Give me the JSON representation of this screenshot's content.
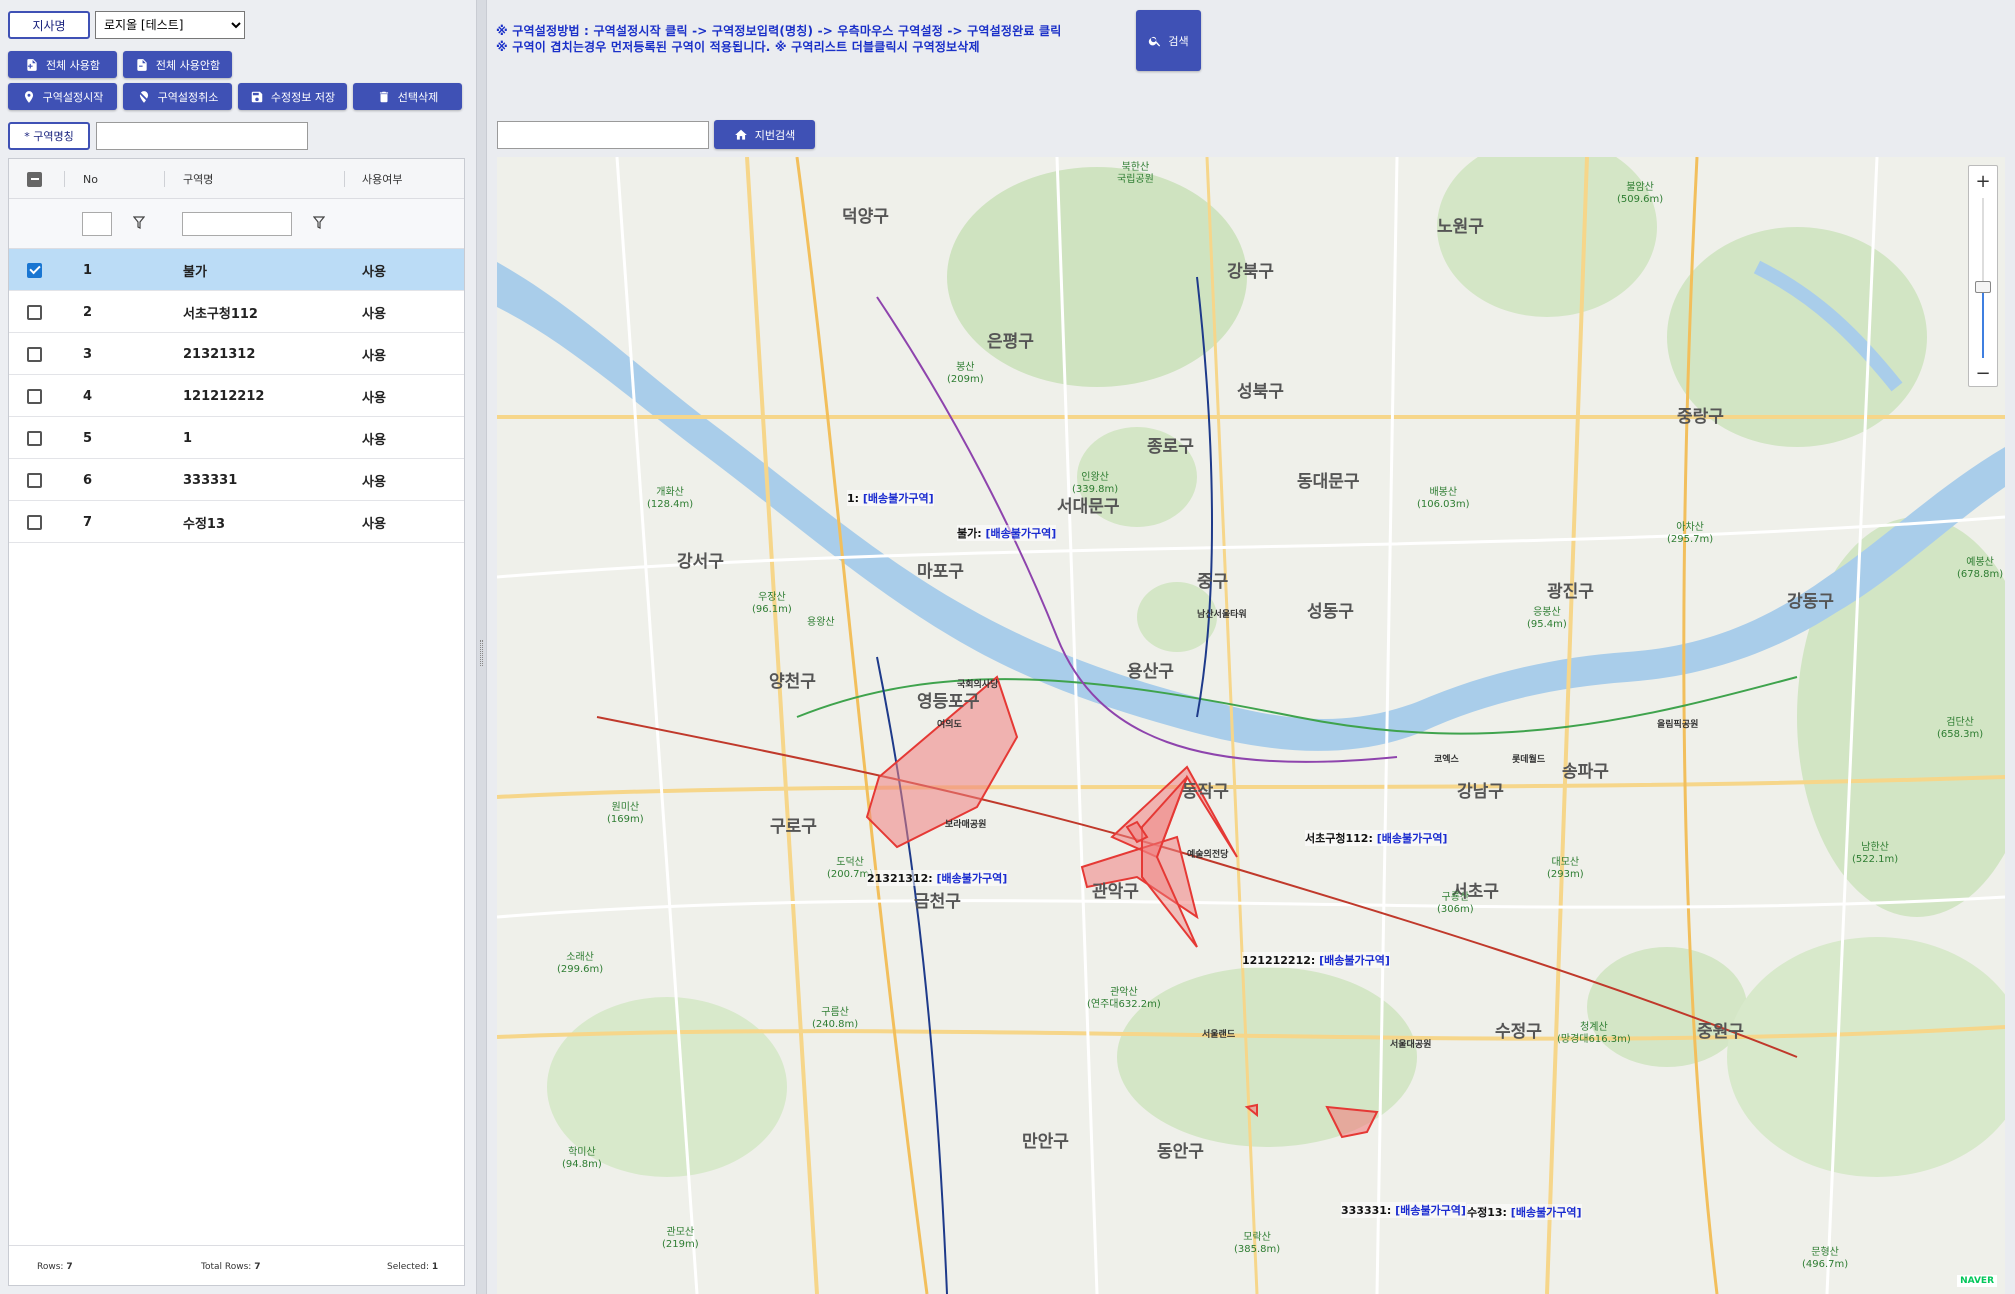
{
  "left_panel": {
    "branch_label": "지사명",
    "branch_select": "로지올 [테스트]",
    "buttons": {
      "enable_all": "전체 사용함",
      "disable_all": "전체 사용안함",
      "start_zone": "구역설정시작",
      "cancel_zone": "구역설정취소",
      "save_edit": "수정정보 저장",
      "delete_selected": "선택삭제"
    },
    "zone_name_label": "* 구역명칭",
    "zone_name_value": "",
    "grid": {
      "headers": {
        "no": "No",
        "name": "구역명",
        "use": "사용여부"
      },
      "rows": [
        {
          "no": "1",
          "name": "불가",
          "use": "사용",
          "checked": true
        },
        {
          "no": "2",
          "name": "서초구청112",
          "use": "사용",
          "checked": false
        },
        {
          "no": "3",
          "name": "21321312",
          "use": "사용",
          "checked": false
        },
        {
          "no": "4",
          "name": "121212212",
          "use": "사용",
          "checked": false
        },
        {
          "no": "5",
          "name": "1",
          "use": "사용",
          "checked": false
        },
        {
          "no": "6",
          "name": "333331",
          "use": "사용",
          "checked": false
        },
        {
          "no": "7",
          "name": "수정13",
          "use": "사용",
          "checked": false
        }
      ],
      "footer": {
        "rows_label": "Rows:",
        "rows": "7",
        "total_label": "Total Rows:",
        "total": "7",
        "selected_label": "Selected:",
        "selected": "1"
      }
    }
  },
  "right_panel": {
    "notice_line1": "※ 구역설정방법 : 구역설정시작 클릭 -> 구역정보입력(명칭) -> 우측마우스 구역설정 -> 구역설정완료 클릭",
    "notice_line2": "※ 구역이 겹치는경우 먼저등록된 구역이 적용됩니다. ※ 구역리스트 더블클릭시 구역정보삭제",
    "search_button": "검색",
    "address_input": "",
    "address_search_button": "지번검색"
  },
  "map": {
    "zone_tag": "[배송불가구역]",
    "zone_labels": [
      {
        "name": "1:",
        "tag": "[배송불가구역]"
      },
      {
        "name": "불가:",
        "tag": "[배송불가구역]"
      },
      {
        "name": "서초구청112:",
        "tag": "[배송불가구역]"
      },
      {
        "name": "21321312:",
        "tag": "[배송불가구역]"
      },
      {
        "name": "121212212:",
        "tag": "[배송불가구역]"
      },
      {
        "name": "333331:",
        "tag": "[배송불가구역]"
      },
      {
        "name": "수정13:",
        "tag": "[배송불가구역]"
      }
    ],
    "districts": [
      "덕양구",
      "강북구",
      "노원구",
      "은평구",
      "성북구",
      "종로구",
      "중랑구",
      "서대문구",
      "동대문구",
      "강서구",
      "마포구",
      "중구",
      "성동구",
      "광진구",
      "강동구",
      "양천구",
      "영등포구",
      "용산구",
      "동작구",
      "구로구",
      "강남구",
      "송파구",
      "서초구",
      "금천구",
      "관악구",
      "수정구",
      "중원구",
      "만안구",
      "동안구"
    ],
    "pois": [
      {
        "t": "북한산",
        "s": "국립공원"
      },
      {
        "t": "불암산",
        "s": "(509.6m)"
      },
      {
        "t": "봉산",
        "s": "(209m)"
      },
      {
        "t": "인왕산",
        "s": "(339.8m)"
      },
      {
        "t": "배봉산",
        "s": "(106.03m)"
      },
      {
        "t": "개화산",
        "s": "(128.4m)"
      },
      {
        "t": "아차산",
        "s": "(295.7m)"
      },
      {
        "t": "우장산",
        "s": "(96.1m)"
      },
      {
        "t": "용왕산",
        "s": ""
      },
      {
        "t": "응봉산",
        "s": "(95.4m)"
      },
      {
        "t": "원미산",
        "s": "(169m)"
      },
      {
        "t": "도덕산",
        "s": "(200.7m)"
      },
      {
        "t": "대모산",
        "s": "(293m)"
      },
      {
        "t": "구룡산",
        "s": "(306m)"
      },
      {
        "t": "예봉산",
        "s": "(678.8m)"
      },
      {
        "t": "검단산",
        "s": "(658.3m)"
      },
      {
        "t": "남한산",
        "s": "(522.1m)"
      },
      {
        "t": "소래산",
        "s": "(299.6m)"
      },
      {
        "t": "구름산",
        "s": "(240.8m)"
      },
      {
        "t": "관악산",
        "s": "(연주대632.2m)"
      },
      {
        "t": "청계산",
        "s": "(망경대616.3m)"
      },
      {
        "t": "학미산",
        "s": "(94.8m)"
      },
      {
        "t": "관모산",
        "s": "(219m)"
      },
      {
        "t": "모락산",
        "s": "(385.8m)"
      },
      {
        "t": "문형산",
        "s": "(496.7m)"
      }
    ],
    "places": [
      "남산서울타워",
      "국회의사당",
      "서울대공원",
      "롯데월드",
      "올림픽공원",
      "코엑스",
      "예술의전당",
      "서울랜드",
      "보라매공원",
      "여의도"
    ],
    "naver_logo": "NAVER"
  },
  "colors": {
    "accent": "#3f51b5",
    "zone_fill": "#f08080",
    "zone_stroke": "#e53935",
    "selected_row": "#bbdcf6"
  }
}
